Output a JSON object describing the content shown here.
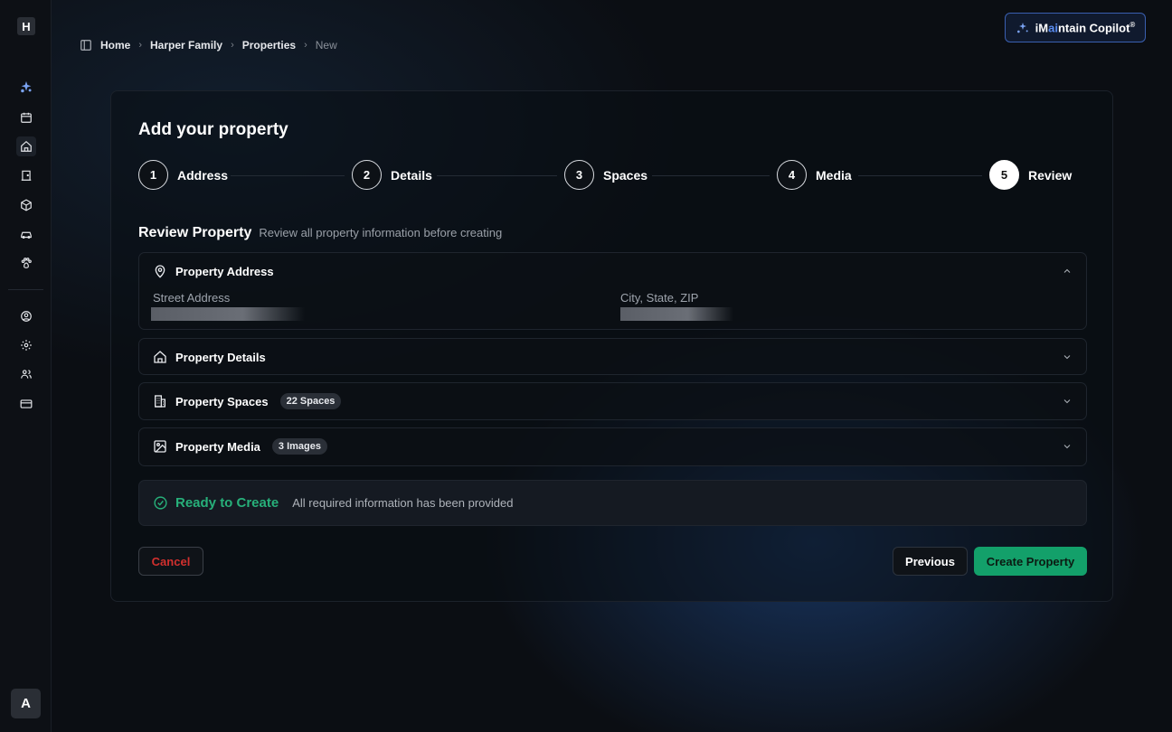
{
  "sidebar": {
    "logo": "H",
    "avatar": "A",
    "icons": [
      "copilot-sparkle-icon",
      "calendar-icon",
      "home-icon",
      "door-icon",
      "package-icon",
      "car-icon",
      "pets-icon",
      "user-circle-icon",
      "gear-icon",
      "users-icon",
      "credit-card-icon"
    ]
  },
  "breadcrumb": {
    "items": [
      "Home",
      "Harper Family",
      "Properties"
    ],
    "current": "New"
  },
  "copilot": {
    "prefix": "iM",
    "ai": "ai",
    "suffix": "ntain Copilot",
    "mark": "®"
  },
  "page": {
    "title": "Add your property"
  },
  "steps": [
    {
      "num": "1",
      "label": "Address"
    },
    {
      "num": "2",
      "label": "Details"
    },
    {
      "num": "3",
      "label": "Spaces"
    },
    {
      "num": "4",
      "label": "Media"
    },
    {
      "num": "5",
      "label": "Review",
      "active": true
    }
  ],
  "review": {
    "title": "Review Property",
    "subtitle": "Review all property information before creating"
  },
  "sections": {
    "address": {
      "title": "Property Address",
      "street_label": "Street Address",
      "city_label": "City, State, ZIP"
    },
    "details": {
      "title": "Property Details"
    },
    "spaces": {
      "title": "Property Spaces",
      "badge": "22 Spaces"
    },
    "media": {
      "title": "Property Media",
      "badge": "3 Images"
    }
  },
  "status": {
    "title": "Ready to Create",
    "message": "All required information has been provided"
  },
  "actions": {
    "cancel": "Cancel",
    "previous": "Previous",
    "create": "Create Property"
  },
  "colors": {
    "accent_green": "#13a06a",
    "cancel_red": "#d2302e",
    "copilot_border": "#3a5fb0"
  }
}
